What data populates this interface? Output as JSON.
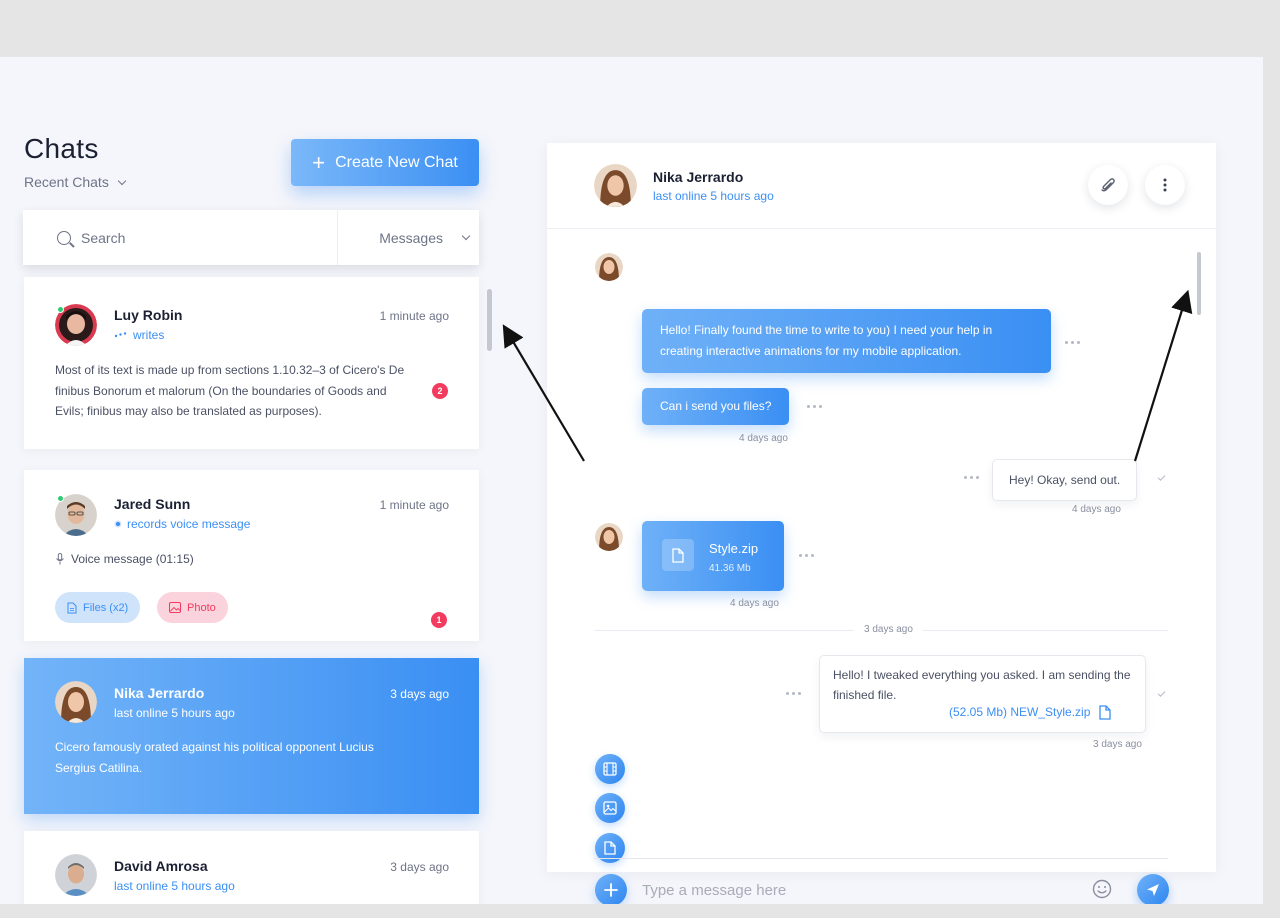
{
  "sidebar": {
    "title": "Chats",
    "recent_label": "Recent Chats",
    "create_label": "Create New Chat",
    "search_placeholder": "Search",
    "filter_label": "Messages"
  },
  "chats": [
    {
      "name": "Luy Robin",
      "status": "writes",
      "time": "1 minute ago",
      "preview": "Most of its text is made up from sections 1.10.32–3 of Cicero's De finibus Bonorum et malorum (On the boundaries of Goods and Evils; finibus may also be translated as purposes).",
      "unread": "2",
      "online": true
    },
    {
      "name": "Jared Sunn",
      "status": "records voice message",
      "time": "1 minute ago",
      "preview": "Voice message (01:15)",
      "unread": "1",
      "online": true,
      "attachments": [
        "Files (x2)",
        "Photo"
      ]
    },
    {
      "name": "Nika Jerrardo",
      "status": "last online 5 hours ago",
      "time": "3 days ago",
      "preview": "Cicero famously orated against his political opponent Lucius Sergius Catilina.",
      "active": true
    },
    {
      "name": "David Amrosa",
      "status": "last online 5 hours ago",
      "time": "3 days ago"
    }
  ],
  "conversation": {
    "name": "Nika Jerrardo",
    "status": "last online 5 hours ago",
    "messages": [
      {
        "dir": "in",
        "text": "Hello! Finally found the time to write to you) I need your help in creating interactive animations for my mobile application."
      },
      {
        "dir": "in",
        "text": "Can i send you files?",
        "time": "4 days ago"
      },
      {
        "dir": "out",
        "text": "Hey! Okay, send out.",
        "time": "4 days ago"
      },
      {
        "dir": "in",
        "file_name": "Style.zip",
        "file_size": "41.36 Mb",
        "time": "4 days ago"
      },
      {
        "dir": "out",
        "text": "Hello! I tweaked everything you asked. I am sending the finished file.",
        "attachment": "(52.05 Mb) NEW_Style.zip",
        "time": "3 days ago"
      }
    ],
    "divider": "3 days ago",
    "composer_placeholder": "Type a message here"
  },
  "colors": {
    "accent": "#3b8ff3",
    "badge": "#f23b5f",
    "online": "#2ecc71",
    "background": "#f5f6fb"
  },
  "icons": [
    "search-icon",
    "chevron-down-icon",
    "plus-icon",
    "paperclip-icon",
    "more-vertical-icon",
    "file-icon",
    "film-icon",
    "image-icon",
    "emoji-icon",
    "send-icon",
    "microphone-icon"
  ]
}
